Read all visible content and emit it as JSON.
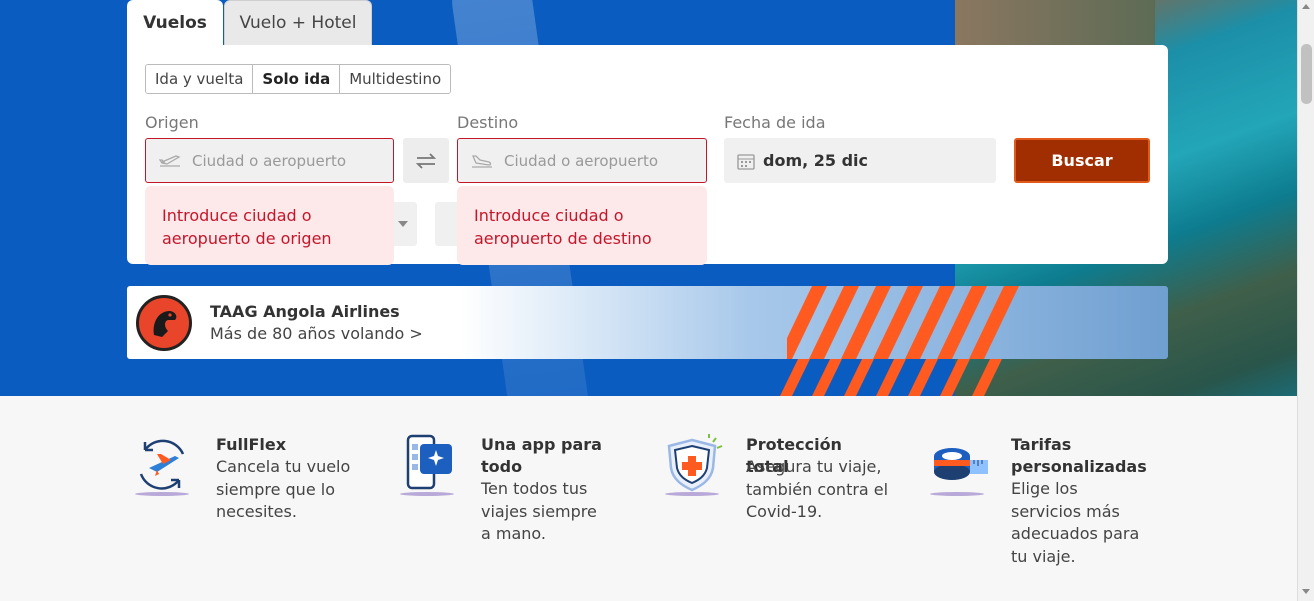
{
  "tabs": [
    {
      "label": "Vuelos",
      "active": true
    },
    {
      "label": "Vuelo + Hotel",
      "active": false
    }
  ],
  "trip_type": {
    "options": [
      "Ida y vuelta",
      "Solo ida",
      "Multidestino"
    ],
    "selected": "Solo ida"
  },
  "origin": {
    "label": "Origen",
    "placeholder": "Ciudad o aeropuerto",
    "error": "Introduce ciudad o aeropuerto de origen",
    "icon": "takeoff-icon"
  },
  "destination": {
    "label": "Destino",
    "placeholder": "Ciudad o aeropuerto",
    "error": "Introduce ciudad o aeropuerto de destino",
    "icon": "landing-icon"
  },
  "date": {
    "label": "Fecha de ida",
    "value": "dom, 25 dic",
    "icon": "calendar-icon"
  },
  "search": {
    "label": "Buscar"
  },
  "banner": {
    "title": "TAAG Angola Airlines",
    "subtitle": "Más de 80 años volando >"
  },
  "features": [
    {
      "title": "FullFlex",
      "text": "Cancela tu vuelo siempre que lo necesites.",
      "icon": "plane-cancel-icon"
    },
    {
      "title": "Una app para todo",
      "text": "Ten todos tus viajes siempre a mano.",
      "icon": "phone-app-icon"
    },
    {
      "title": "Protección total",
      "text": "Asegura tu viaje, también contra el Covid-19.",
      "icon": "shield-icon"
    },
    {
      "title": "Tarifas personalizadas",
      "text": "Elige los servicios más adecuados para tu viaje.",
      "icon": "measuring-tape-icon"
    }
  ],
  "colors": {
    "hero_blue": "#0a5cc0",
    "error_red": "#c4162a",
    "search_button": "#a12e00",
    "accent_orange": "#ff5a1f"
  }
}
